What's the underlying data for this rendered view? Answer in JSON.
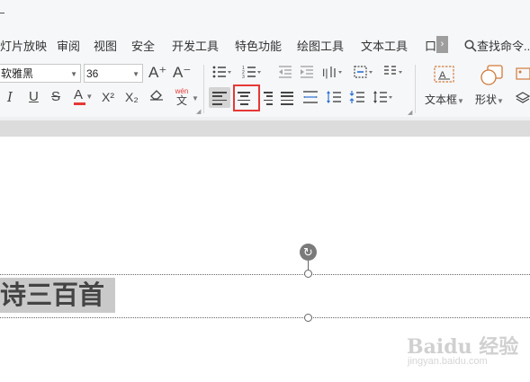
{
  "menu": {
    "items": [
      "灯片放映",
      "审阅",
      "视图",
      "安全",
      "开发工具",
      "特色功能",
      "绘图工具",
      "文本工具"
    ],
    "collapsed_label": "口",
    "scroll_glyph": "›",
    "search_label": "查找命令..."
  },
  "font": {
    "family_value": "软雅黑",
    "size_value": "36"
  },
  "ribbon": {
    "textbox_label": "文本框",
    "shape_label": "形状",
    "pinyin_label": "wén",
    "pinyin_char": "文",
    "grow_font_glyph": "A⁺",
    "shrink_font_glyph": "A⁻",
    "font_color_glyph": "A",
    "superscript_glyph": "X²",
    "subscript_glyph": "X₂",
    "italic_glyph": "I",
    "underline_glyph": "U",
    "strike_glyph": "S"
  },
  "canvas": {
    "title_text": "诗三百首",
    "rotate_glyph": "↻"
  },
  "watermark": {
    "brand": "Baidu 经验",
    "url": "jingyan.baidu.com"
  },
  "colors": {
    "accent_red": "#e53935",
    "font_color_underline": "#e53935",
    "text_highlight": "#c9c9c9"
  }
}
